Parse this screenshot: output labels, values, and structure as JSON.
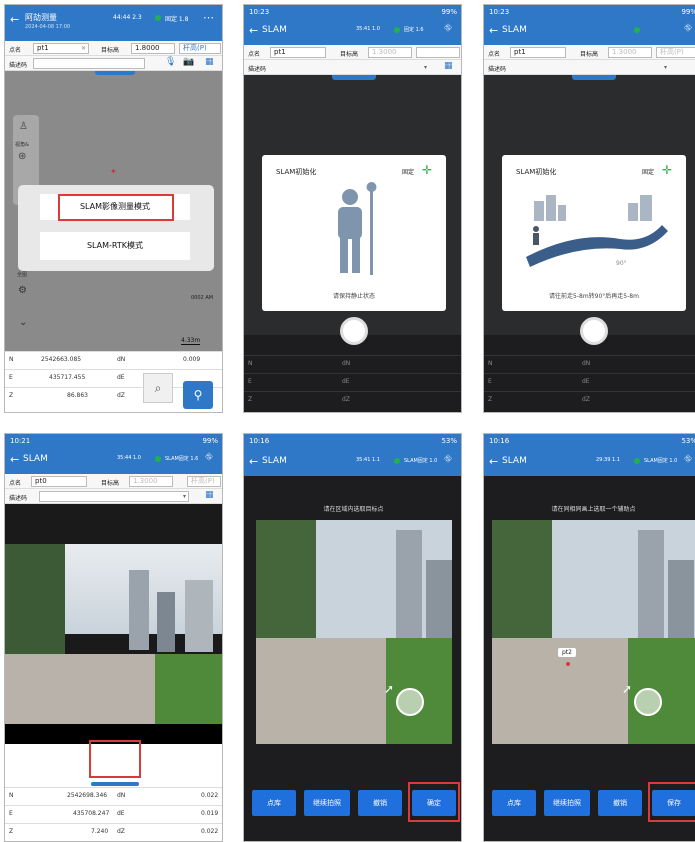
{
  "panel1": {
    "title": "阿劼测量",
    "subtitle": "2024-04-08 17:00",
    "status_sat": "44:44 2.3",
    "status_fix": "固定 1.8",
    "point_name_label": "点名",
    "point_name": "pt1",
    "target_height_label": "目标高",
    "target_height": "1.8000",
    "measure_mode": "杆高(P)",
    "desc_label": "描述码",
    "tool_label": "视角&",
    "full_label": "全图",
    "menu_option_1": "SLAM影像测量模式",
    "menu_option_2": "SLAM-RTK模式",
    "scale_text": "4.33m",
    "map_info": "0002 AM",
    "north": "2542663.085",
    "dn": "0.009",
    "east": "435717.455",
    "de": "",
    "z": "86.863",
    "dz": ""
  },
  "panel2": {
    "time": "10:23",
    "battery": "99%",
    "title": "SLAM",
    "status_sat": "35:41 1.0",
    "status_fix": "固定 1.6",
    "point_name_label": "点名",
    "point_name": "pt1",
    "target_height_label": "目标高",
    "target_height": "1.3000",
    "desc_label": "描述码",
    "dialog_title": "SLAM初始化",
    "dialog_status": "固定",
    "dialog_hint": "请保持静止状态",
    "n_label": "N",
    "dn_label": "dN",
    "e_label": "E",
    "de_label": "dE",
    "z_label": "Z",
    "dz_label": "dZ"
  },
  "panel3": {
    "time": "10:23",
    "battery": "99%",
    "title": "SLAM",
    "point_name_label": "点名",
    "point_name": "pt1",
    "target_height_label": "目标高",
    "target_height": "1.3000",
    "measure_mode": "杆高(P)",
    "desc_label": "描述码",
    "dialog_title": "SLAM初始化",
    "dialog_status": "固定",
    "angle": "90°",
    "dialog_hint": "请往前走5-8m转90°后再走5-8m",
    "n_label": "N",
    "dn_label": "dN",
    "e_label": "E",
    "de_label": "dE",
    "z_label": "Z",
    "dz_label": "dZ"
  },
  "panel4": {
    "time": "10:21",
    "battery": "99%",
    "title": "SLAM",
    "status_sat": "35:44 1.0",
    "status_fix": "SLAM固定 1.6",
    "point_name_label": "点名",
    "point_name": "pt0",
    "target_height_label": "目标高",
    "target_height": "1.3000",
    "measure_mode": "杆高(P)",
    "desc_label": "描述码",
    "north": "2542698.346",
    "dn": "0.022",
    "east": "435708.247",
    "de": "0.019",
    "z": "7.240",
    "dz": "0.022",
    "n_label": "N",
    "dn_label": "dN",
    "e_label": "E",
    "de_label": "dE",
    "z_label": "Z",
    "dz_label": "dZ"
  },
  "panel5": {
    "time": "10:16",
    "battery": "53%",
    "title": "SLAM",
    "status_sat": "35:41 1.1",
    "status_fix": "SLAM固定 1.0",
    "instruction": "请在区域内选取目标点",
    "btn_library": "点库",
    "btn_continue": "继续拍照",
    "btn_undo": "撤销",
    "btn_confirm": "确定"
  },
  "panel6": {
    "time": "10:16",
    "battery": "53%",
    "title": "SLAM",
    "status_sat": "29:39 1.1",
    "status_fix": "SLAM固定 1.0",
    "instruction": "请在同相同画上选取一个辅助点",
    "point_label": "pt2",
    "btn_library": "点库",
    "btn_continue": "继续拍照",
    "btn_undo": "撤销",
    "btn_save": "保存"
  },
  "colors": {
    "primary_blue": "#2f78c8",
    "button_blue": "#1f6fdc",
    "highlight_red": "#d93a3a",
    "fix_green": "#22b14c"
  }
}
